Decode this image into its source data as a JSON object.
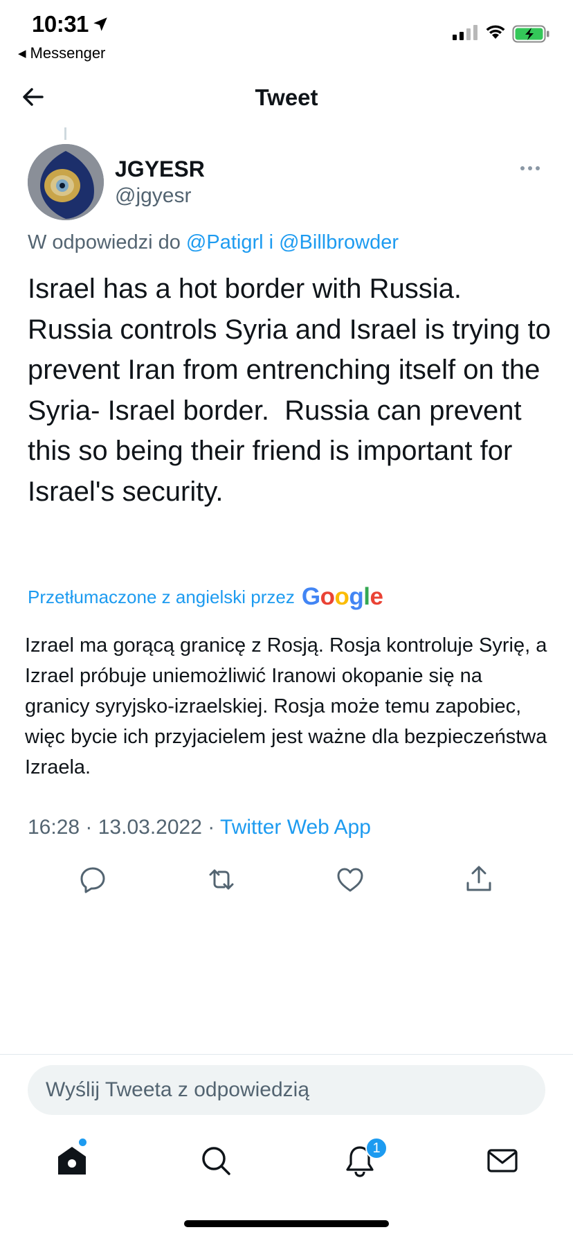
{
  "status_bar": {
    "time": "10:31",
    "back_app": "Messenger",
    "icons": [
      "location-arrow-icon",
      "cellular-signal-icon",
      "wifi-icon",
      "battery-charging-icon"
    ]
  },
  "nav": {
    "title": "Tweet",
    "back_icon": "arrow-left-icon"
  },
  "tweet": {
    "author_name": "JGYESR",
    "author_handle": "@jgyesr",
    "reply_prefix": "W odpowiedzi do ",
    "reply_targets": "@Patigrl i @Billbrowder",
    "text": "Israel has a hot border with Russia. Russia controls Syria and Israel is trying to prevent Iran from entrenching itself on the Syria- Israel border.  Russia can prevent this so being their friend is important for Israel's security.",
    "translated_label": "Przetłumaczone z angielski przez",
    "translation_provider": "Google",
    "translation": "Izrael ma gorącą granicę z Rosją. Rosja kontroluje Syrię, a Izrael próbuje uniemożliwić Iranowi okopanie się na granicy syryjsko-izraelskiej. Rosja może temu zapobiec, więc bycie ich przyjacielem jest ważne dla bezpieczeństwa Izraela.",
    "time": "16:28",
    "date": "13.03.2022",
    "source": "Twitter Web App",
    "separator": " · "
  },
  "actions": [
    "reply-icon",
    "retweet-icon",
    "like-icon",
    "share-icon"
  ],
  "composer": {
    "placeholder": "Wyślij Tweeta z odpowiedzią"
  },
  "tab_bar": {
    "tabs": [
      "home-icon",
      "search-icon",
      "notifications-icon",
      "messages-icon"
    ],
    "notification_count": "1"
  },
  "colors": {
    "accent": "#1d9bf0",
    "text": "#0f1419",
    "secondary": "#536471"
  }
}
